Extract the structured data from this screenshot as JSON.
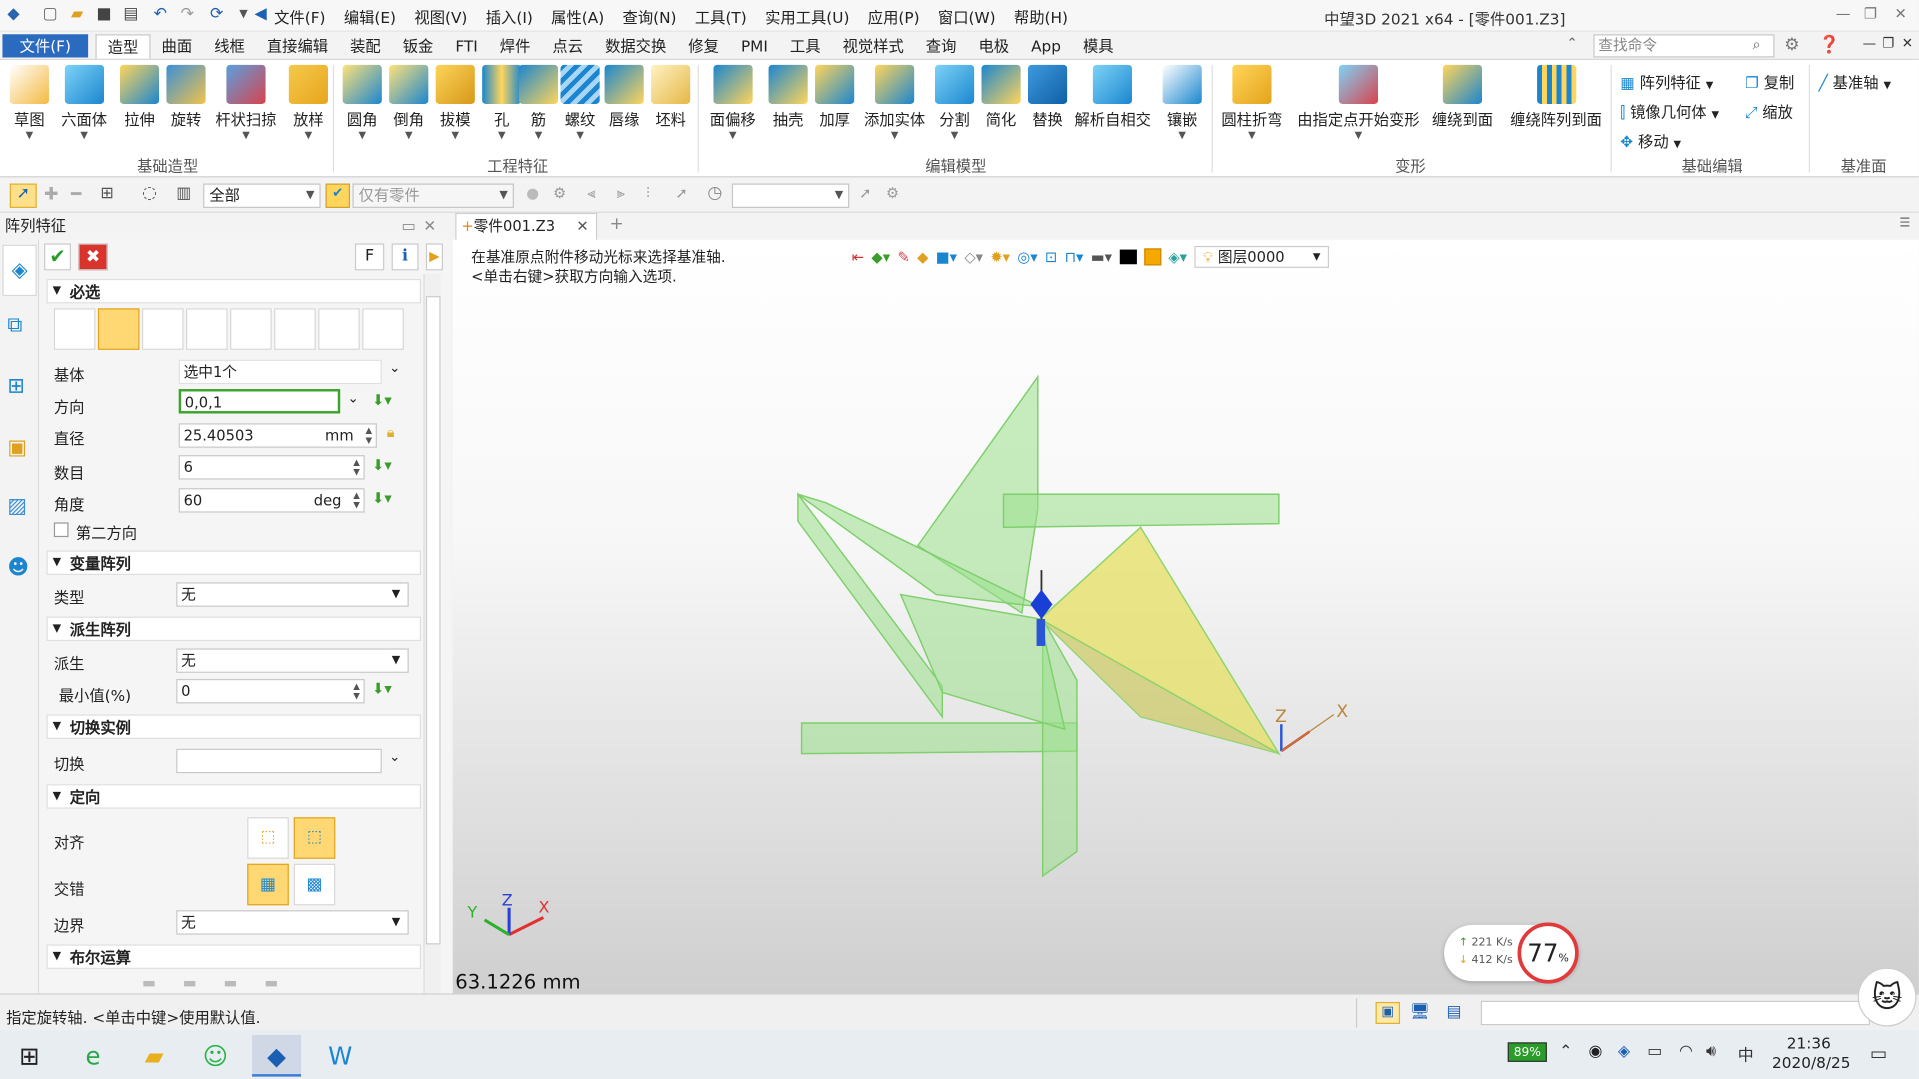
{
  "app": {
    "title": "中望3D 2021 x64 - [零件001.Z3]",
    "menu": [
      "文件(F)",
      "编辑(E)",
      "视图(V)",
      "插入(I)",
      "属性(A)",
      "查询(N)",
      "工具(T)",
      "实用工具(U)",
      "应用(P)",
      "窗口(W)",
      "帮助(H)"
    ]
  },
  "tabs": {
    "file": "文件(F)",
    "items": [
      "造型",
      "曲面",
      "线框",
      "直接编辑",
      "装配",
      "钣金",
      "FTI",
      "焊件",
      "点云",
      "数据交换",
      "修复",
      "PMI",
      "工具",
      "视觉样式",
      "查询",
      "电极",
      "App",
      "模具"
    ],
    "active": "造型",
    "search_placeholder": "查找命令"
  },
  "ribbon": {
    "groups": {
      "basic": "基础造型",
      "engineering": "工程特征",
      "edit_model": "编辑模型",
      "deform": "变形",
      "basic_edit": "基础编辑",
      "datum": "基准面"
    },
    "basic_buttons": [
      "草图",
      "六面体",
      "拉伸",
      "旋转",
      "杆状扫掠",
      "放样"
    ],
    "engineering_buttons": [
      "圆角",
      "倒角",
      "拔模",
      "孔",
      "筋",
      "螺纹",
      "唇缘",
      "坯料"
    ],
    "edit_buttons": [
      "面偏移",
      "抽壳",
      "加厚",
      "添加实体",
      "分割",
      "简化",
      "替换",
      "解析自相交",
      "镶嵌"
    ],
    "deform_buttons": [
      "圆柱折弯",
      "由指定点开始变形",
      "缠绕到面",
      "缠绕阵列到面"
    ],
    "basic_edit": {
      "pattern": "阵列特征",
      "mirror": "镜像几何体",
      "move": "移动",
      "copy": "复制",
      "scale": "缩放"
    },
    "datum_axis": "基准轴"
  },
  "toolbar2": {
    "filter": "全部",
    "filter2": "仅有零件"
  },
  "panel": {
    "title": "阵列特征",
    "f_button": "F",
    "sections": {
      "required": "必选",
      "variable": "变量阵列",
      "derived": "派生阵列",
      "toggle": "切换实例",
      "orient": "定向",
      "boolean": "布尔运算"
    },
    "fields": {
      "base_label": "基体",
      "base_value": "选中1个",
      "direction_label": "方向",
      "direction_value": "0,0,1",
      "diameter_label": "直径",
      "diameter_value": "25.40503",
      "diameter_unit": "mm",
      "count_label": "数目",
      "count_value": "6",
      "angle_label": "角度",
      "angle_value": "60",
      "angle_unit": "deg",
      "second_dir": "第二方向",
      "type_label": "类型",
      "type_value": "无",
      "derive_label": "派生",
      "derive_value": "无",
      "min_label": "最小值(%)",
      "min_value": "0",
      "toggle_label": "切换",
      "align_label": "对齐",
      "stagger_label": "交错",
      "boundary_label": "边界",
      "boundary_value": "无"
    }
  },
  "viewport": {
    "tab": "零件001.Z3",
    "prompt_line1": "在基准原点附件移动光标来选择基准轴.",
    "prompt_line2": "<单击右键>获取方向输入选项.",
    "layer": "图层0000",
    "measure": "63.1226 mm",
    "axes": {
      "x": "X",
      "y": "Y",
      "z": "Z"
    },
    "net": {
      "up": "221 K/s",
      "down": "412 K/s",
      "percent": "77",
      "pct_sign": "%"
    }
  },
  "status": {
    "text": "指定旋转轴. <单击中键>使用默认值."
  },
  "taskbar": {
    "battery": "89%",
    "time": "21:36",
    "date": "2020/8/25"
  }
}
